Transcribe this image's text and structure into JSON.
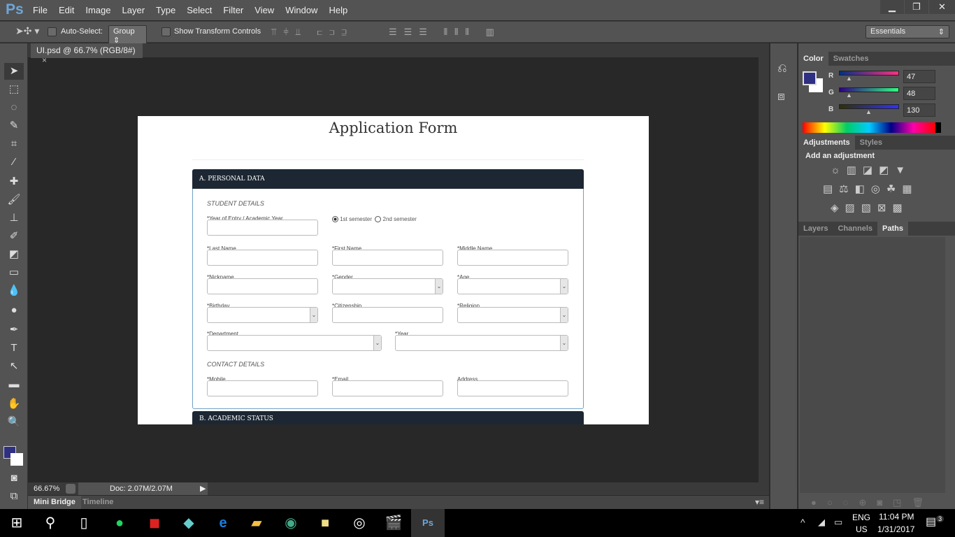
{
  "app": {
    "logo": "Ps",
    "menu": [
      "File",
      "Edit",
      "Image",
      "Layer",
      "Type",
      "Select",
      "Filter",
      "View",
      "Window",
      "Help"
    ],
    "window_controls": [
      "minimize",
      "restore",
      "close"
    ]
  },
  "options": {
    "auto_select_label": "Auto-Select:",
    "auto_select_checked": false,
    "group_value": "Group",
    "show_transform_label": "Show Transform Controls",
    "show_transform_checked": false,
    "workspace": "Essentials"
  },
  "document_tab": {
    "title": "UI.psd @ 66.7% (RGB/8#)",
    "close": "×"
  },
  "tools": [
    "move",
    "marquee",
    "lasso",
    "quick-select",
    "crop",
    "eyedropper",
    "healing",
    "brush",
    "stamp",
    "history-brush",
    "eraser",
    "gradient",
    "blur",
    "dodge",
    "pen",
    "type",
    "path-select",
    "shape",
    "hand",
    "zoom"
  ],
  "status": {
    "zoom": "66.67%",
    "doc": "Doc: 2.07M/2.07M"
  },
  "bottom_tabs": [
    "Mini Bridge",
    "Timeline"
  ],
  "color_panel": {
    "tabs": [
      "Color",
      "Swatches"
    ],
    "foreground": "#2f3082",
    "R": {
      "label": "R",
      "value": "47"
    },
    "G": {
      "label": "G",
      "value": "48"
    },
    "B": {
      "label": "B",
      "value": "130"
    }
  },
  "adjustments_panel": {
    "tabs": [
      "Adjustments",
      "Styles"
    ],
    "heading": "Add an adjustment"
  },
  "layers_panel": {
    "tabs": [
      "Layers",
      "Channels",
      "Paths"
    ],
    "active": "Paths"
  },
  "form": {
    "title": "Application Form",
    "section_a": "A. PERSONAL DATA",
    "student_details": "STUDENT DETAILS",
    "semester_1": "1st semester",
    "semester_2": "2nd semester",
    "semester_selected": "1st semester",
    "contact_details": "CONTACT DETAILS",
    "section_b": "B. ACADEMIC STATUS",
    "fields": [
      {
        "label": "*Year of Entry / Academic Year",
        "type": "text"
      },
      {
        "label": "*Last Name",
        "type": "text"
      },
      {
        "label": "*First Name",
        "type": "text"
      },
      {
        "label": "*Middle Name",
        "type": "text"
      },
      {
        "label": "*Nickname",
        "type": "text"
      },
      {
        "label": "*Gender",
        "type": "select"
      },
      {
        "label": "*Age",
        "type": "select"
      },
      {
        "label": "*Birthday",
        "type": "select"
      },
      {
        "label": "*Citizenship",
        "type": "text"
      },
      {
        "label": "*Religion",
        "type": "select"
      },
      {
        "label": "*Department",
        "type": "select"
      },
      {
        "label": "*Year",
        "type": "select"
      },
      {
        "label": "*Mobile",
        "type": "text"
      },
      {
        "label": "*Email",
        "type": "text"
      },
      {
        "label": "Address",
        "type": "text"
      }
    ]
  },
  "taskbar": {
    "apps": [
      "spotify",
      "game-app",
      "crystal-app",
      "edge",
      "file-explorer",
      "chrome",
      "sticky-notes",
      "groove",
      "movies",
      "photoshop"
    ],
    "lang1": "ENG",
    "lang2": "US",
    "time": "11:04 PM",
    "date": "1/31/2017",
    "notifications": "3"
  }
}
